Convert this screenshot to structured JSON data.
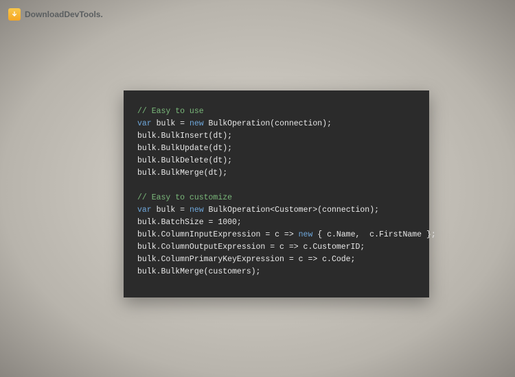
{
  "brand": {
    "text": "DownloadDevTools.",
    "icon_name": "download-arrow-icon"
  },
  "code": {
    "lines": [
      {
        "segments": [
          {
            "cls": "tok-comment",
            "text": "// Easy to use"
          }
        ]
      },
      {
        "segments": [
          {
            "cls": "tok-keyword",
            "text": "var"
          },
          {
            "cls": "tok-plain",
            "text": " bulk = "
          },
          {
            "cls": "tok-keyword",
            "text": "new"
          },
          {
            "cls": "tok-plain",
            "text": " BulkOperation(connection);"
          }
        ]
      },
      {
        "segments": [
          {
            "cls": "tok-plain",
            "text": "bulk.BulkInsert(dt);"
          }
        ]
      },
      {
        "segments": [
          {
            "cls": "tok-plain",
            "text": "bulk.BulkUpdate(dt);"
          }
        ]
      },
      {
        "segments": [
          {
            "cls": "tok-plain",
            "text": "bulk.BulkDelete(dt);"
          }
        ]
      },
      {
        "segments": [
          {
            "cls": "tok-plain",
            "text": "bulk.BulkMerge(dt);"
          }
        ]
      },
      {
        "blank": true
      },
      {
        "segments": [
          {
            "cls": "tok-comment",
            "text": "// Easy to customize"
          }
        ]
      },
      {
        "segments": [
          {
            "cls": "tok-keyword",
            "text": "var"
          },
          {
            "cls": "tok-plain",
            "text": " bulk = "
          },
          {
            "cls": "tok-keyword",
            "text": "new"
          },
          {
            "cls": "tok-plain",
            "text": " BulkOperation<Customer>(connection);"
          }
        ]
      },
      {
        "segments": [
          {
            "cls": "tok-plain",
            "text": "bulk.BatchSize = 1000;"
          }
        ]
      },
      {
        "segments": [
          {
            "cls": "tok-plain",
            "text": "bulk.ColumnInputExpression = c => "
          },
          {
            "cls": "tok-keyword",
            "text": "new"
          },
          {
            "cls": "tok-plain",
            "text": " { c.Name,  c.FirstName };"
          }
        ]
      },
      {
        "segments": [
          {
            "cls": "tok-plain",
            "text": "bulk.ColumnOutputExpression = c => c.CustomerID;"
          }
        ]
      },
      {
        "segments": [
          {
            "cls": "tok-plain",
            "text": "bulk.ColumnPrimaryKeyExpression = c => c.Code;"
          }
        ]
      },
      {
        "segments": [
          {
            "cls": "tok-plain",
            "text": "bulk.BulkMerge(customers);"
          }
        ]
      }
    ]
  }
}
